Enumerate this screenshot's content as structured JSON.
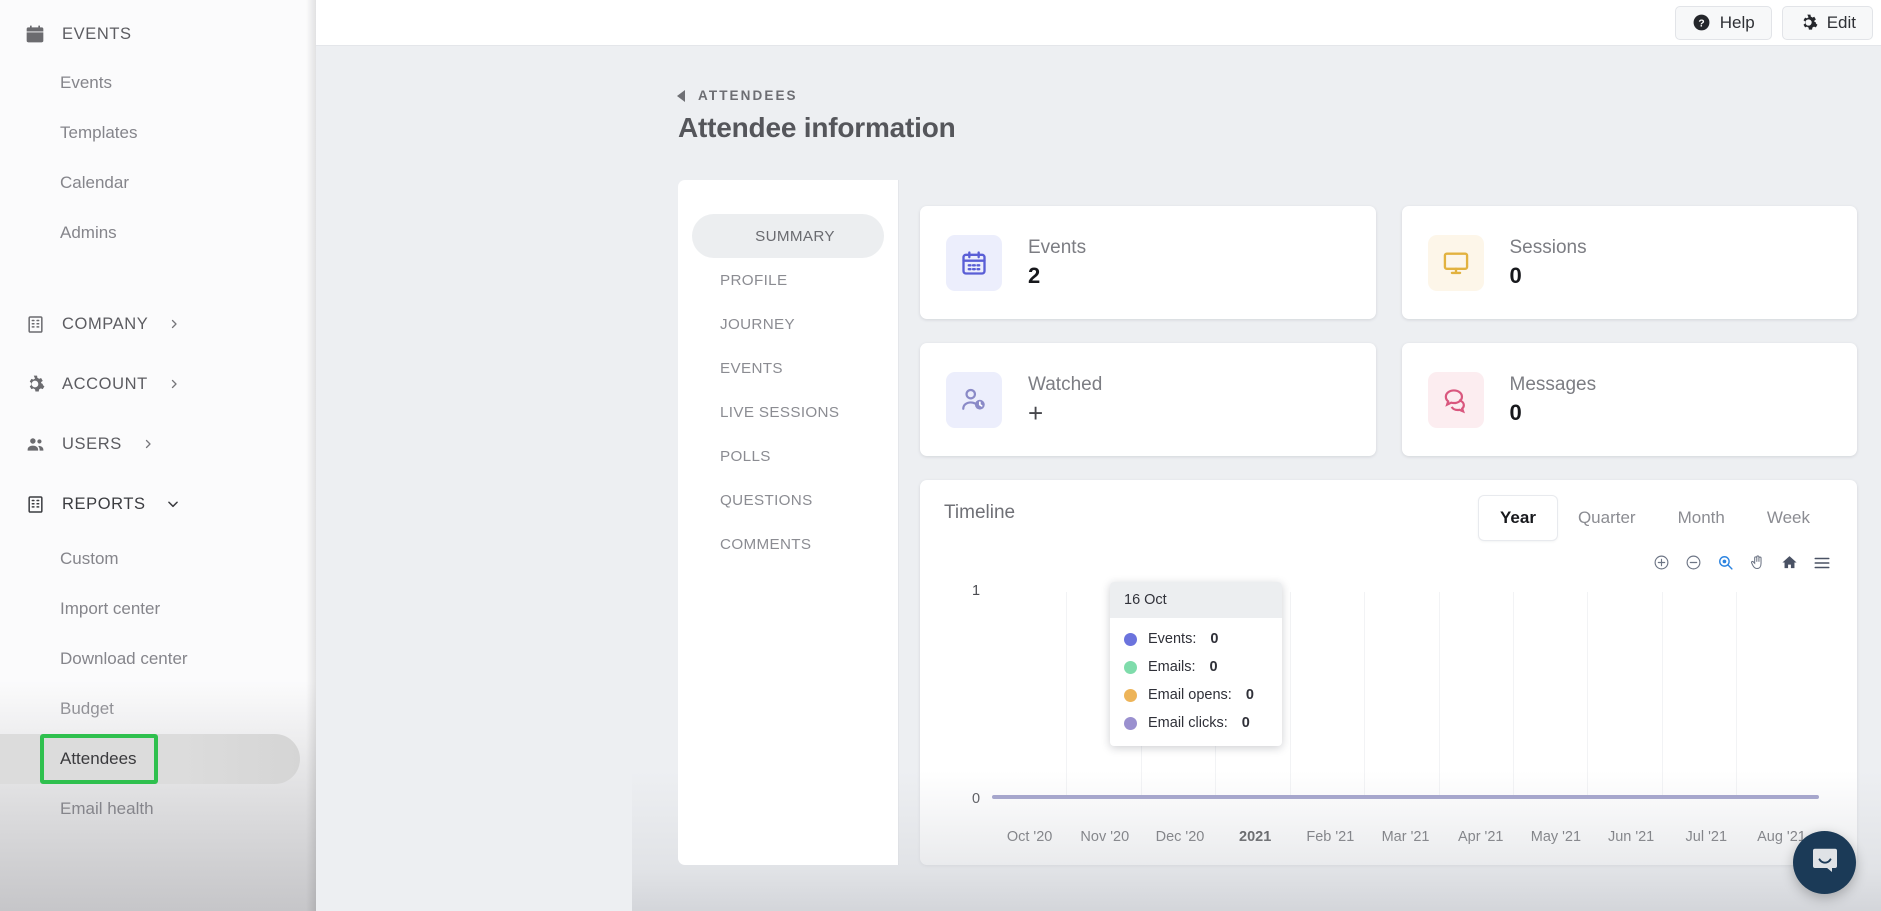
{
  "topbar": {
    "help_label": "Help",
    "edit_label": "Edit"
  },
  "sidebar": {
    "sections": [
      {
        "label": "EVENTS",
        "icon": "calendar-icon",
        "chevron": "",
        "items": [
          "Events",
          "Templates",
          "Calendar",
          "Admins"
        ]
      },
      {
        "label": "COMPANY",
        "icon": "building-icon",
        "chevron": "›",
        "items": []
      },
      {
        "label": "ACCOUNT",
        "icon": "gear-icon",
        "chevron": "›",
        "items": []
      },
      {
        "label": "USERS",
        "icon": "users-icon",
        "chevron": "›",
        "items": []
      },
      {
        "label": "REPORTS",
        "icon": "building-icon",
        "chevron": "⌄",
        "items": [
          "Custom",
          "Import center",
          "Download center",
          "Budget",
          "Attendees",
          "Email health"
        ]
      }
    ],
    "active_item": "Attendees",
    "highlight_color": "#2fc04e"
  },
  "breadcrumb": {
    "back_label": "ATTENDEES"
  },
  "page": {
    "title": "Attendee information"
  },
  "tabs": {
    "items": [
      "SUMMARY",
      "PROFILE",
      "JOURNEY",
      "EVENTS",
      "LIVE SESSIONS",
      "POLLS",
      "QUESTIONS",
      "COMMENTS"
    ],
    "active": "SUMMARY"
  },
  "stats": [
    {
      "label": "Events",
      "value": "2",
      "icon": "calendar-icon",
      "tone": "purple",
      "color": "#5a5ed6"
    },
    {
      "label": "Sessions",
      "value": "0",
      "icon": "monitor-icon",
      "tone": "yellow",
      "color": "#e2b23f"
    },
    {
      "label": "Watched",
      "value": "+",
      "icon": "user-clock-icon",
      "tone": "purple",
      "color": "#8a8ac7"
    },
    {
      "label": "Messages",
      "value": "0",
      "icon": "chat-icon",
      "tone": "pink",
      "color": "#d9577e"
    }
  ],
  "timeline": {
    "title": "Timeline",
    "periods": [
      "Year",
      "Quarter",
      "Month",
      "Week"
    ],
    "active_period": "Year",
    "tools": [
      {
        "name": "zoom-in-icon",
        "active": false
      },
      {
        "name": "zoom-out-icon",
        "active": false
      },
      {
        "name": "selection-zoom-icon",
        "active": true
      },
      {
        "name": "pan-icon",
        "active": false
      },
      {
        "name": "home-reset-icon",
        "active": false
      },
      {
        "name": "menu-icon",
        "active": false
      }
    ],
    "tooltip": {
      "date": "16 Oct",
      "rows": [
        {
          "label": "Events:",
          "value": "0",
          "color": "#6b73dd"
        },
        {
          "label": "Emails:",
          "value": "0",
          "color": "#7fdcab"
        },
        {
          "label": "Email opens:",
          "value": "0",
          "color": "#edb459"
        },
        {
          "label": "Email clicks:",
          "value": "0",
          "color": "#9a90cf"
        }
      ]
    }
  },
  "chart_data": {
    "type": "line",
    "title": "Timeline",
    "xlabel": "",
    "ylabel": "",
    "ylim": [
      0,
      1
    ],
    "ytick_labels": [
      "0",
      "1"
    ],
    "grid": true,
    "legend_position": "none",
    "categories": [
      "Oct '20",
      "Nov '20",
      "Dec '20",
      "2021",
      "Feb '21",
      "Mar '21",
      "Apr '21",
      "May '21",
      "Jun '21",
      "Jul '21",
      "Aug '21"
    ],
    "bold_categories": [
      "2021"
    ],
    "series": [
      {
        "name": "Events",
        "color": "#6b73dd",
        "values": [
          0,
          0,
          0,
          0,
          0,
          0,
          0,
          0,
          0,
          0,
          0
        ]
      },
      {
        "name": "Emails",
        "color": "#7fdcab",
        "values": [
          0,
          0,
          0,
          0,
          0,
          0,
          0,
          0,
          0,
          0,
          0
        ]
      },
      {
        "name": "Email opens",
        "color": "#edb459",
        "values": [
          0,
          0,
          0,
          0,
          0,
          0,
          0,
          0,
          0,
          0,
          0
        ]
      },
      {
        "name": "Email clicks",
        "color": "#9a90cf",
        "values": [
          0,
          0,
          0,
          0,
          0,
          0,
          0,
          0,
          0,
          0,
          0
        ]
      }
    ],
    "hover_point": {
      "x": "16 Oct",
      "values": {
        "Events": 0,
        "Emails": 0,
        "Email opens": 0,
        "Email clicks": 0
      }
    }
  },
  "chat": {
    "icon": "intercom-chat-icon"
  }
}
